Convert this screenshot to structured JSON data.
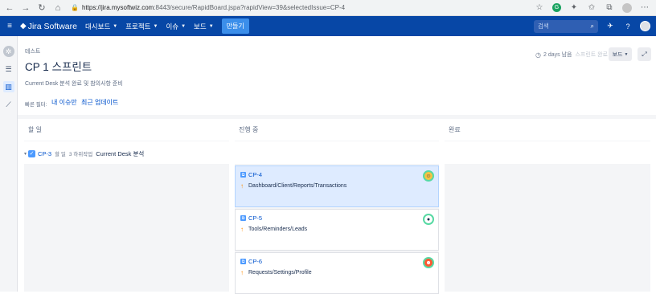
{
  "browser": {
    "url_host": "https://jira.mysoftwiz.com",
    "url_rest": ":8443/secure/RapidBoard.jspa?rapidView=39&selectedIssue=CP-4"
  },
  "topnav": {
    "logo": "Jira Software",
    "items": [
      "대시보드",
      "프로젝트",
      "이슈",
      "보드"
    ],
    "create": "만들기",
    "search_placeholder": "검색"
  },
  "header": {
    "breadcrumb": "테스트",
    "title": "CP 1 스프린트",
    "goal": "Current Desk 분석 완료 및 참의사항 준비",
    "quick_filters_label": "빠른 필터:",
    "quick_filters": [
      "내 이슈만",
      "최근 업데이트"
    ],
    "days_remaining": "2 days 남음",
    "complete_sprint": "스프린트 완료",
    "board_button": "보드"
  },
  "columns": [
    "할 일",
    "진행 중",
    "완료"
  ],
  "swimlane": {
    "key": "CP-3",
    "status": "할 일",
    "subtasks": "3 하위작업",
    "summary": "Current Desk 분석"
  },
  "cards": [
    {
      "key": "CP-4",
      "summary": "Dashboard/Client/Reports/Transactions",
      "avatar_color": "#f6c342"
    },
    {
      "key": "CP-5",
      "summary": "Tools/Reminders/Leads",
      "avatar_color": "#ffffff"
    },
    {
      "key": "CP-6",
      "summary": "Requests/Settings/Profile",
      "avatar_color": "#ff5630"
    }
  ],
  "colors": {
    "topnav": "#0747a6",
    "link": "#0052cc",
    "selected_card": "#deebff"
  }
}
